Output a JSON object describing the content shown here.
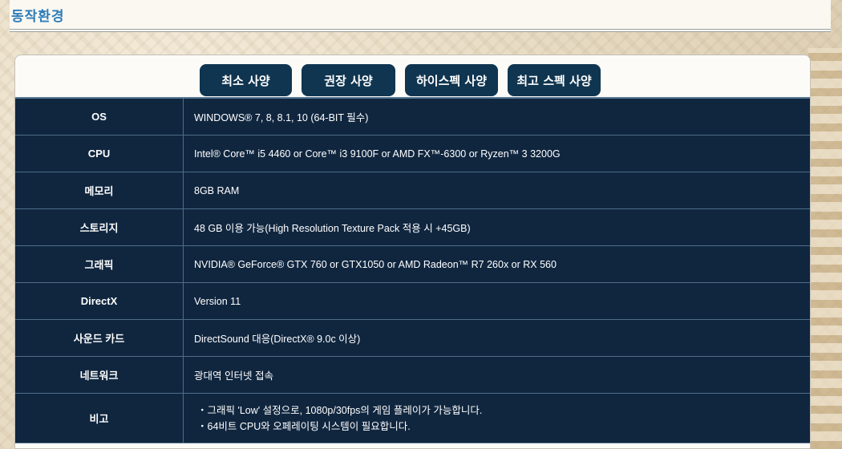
{
  "header": {
    "title": "동작환경"
  },
  "tabs": [
    {
      "label": "최소 사양",
      "active": true
    },
    {
      "label": "권장 사양",
      "active": false
    },
    {
      "label": "하이스펙 사양",
      "active": false
    },
    {
      "label": "최고 스펙 사양",
      "active": false
    }
  ],
  "colors": {
    "header_text": "#2e7db8",
    "tab_bg": "#0f3550",
    "table_bg": "#10263f",
    "table_border": "#4f6d88"
  },
  "specs": [
    {
      "label": "OS",
      "value": "WINDOWS® 7, 8, 8.1, 10 (64-BIT 필수)"
    },
    {
      "label": "CPU",
      "value": "Intel® Core™ i5 4460 or Core™ i3 9100F or AMD FX™-6300 or Ryzen™ 3 3200G"
    },
    {
      "label": "메모리",
      "value": "8GB RAM"
    },
    {
      "label": "스토리지",
      "value": "48 GB 이용 가능(High Resolution Texture Pack 적용 시 +45GB)"
    },
    {
      "label": "그래픽",
      "value": "NVIDIA® GeForce® GTX 760 or GTX1050 or AMD Radeon™ R7 260x or RX 560"
    },
    {
      "label": "DirectX",
      "value": "Version 11"
    },
    {
      "label": "사운드 카드",
      "value": "DirectSound 대응(DirectX® 9.0c 이상)"
    },
    {
      "label": "네트워크",
      "value": "광대역 인터넷 접속"
    }
  ],
  "notes": {
    "label": "비고",
    "lines": [
      "・그래픽 'Low' 설정으로, 1080p/30fps의 게임 플레이가 가능합니다.",
      "・64비트 CPU와 오페레이팅 시스템이 필요합니다."
    ]
  }
}
